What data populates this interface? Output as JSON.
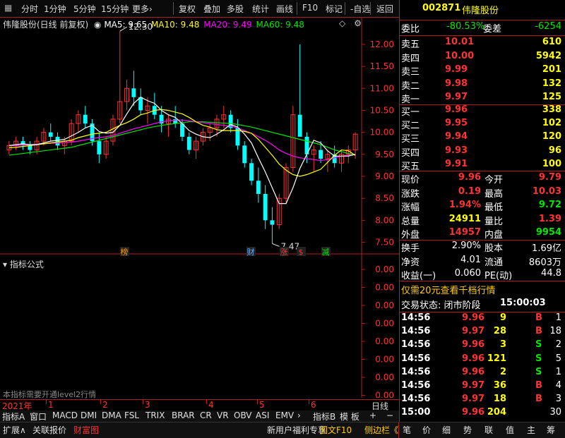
{
  "toolbar": {
    "items": [
      "分时",
      "1分钟",
      "5分钟",
      "15分钟",
      "更多›",
      "复权",
      "叠加",
      "多股",
      "统计",
      "画线",
      "F10",
      "标记",
      "-自选",
      "返回"
    ]
  },
  "chart": {
    "title": "伟隆股份(日线 前复权)",
    "ma5": "MA5: 9.65",
    "ma10": "MA10: 9.48",
    "ma20": "MA20: 9.49",
    "ma60": "MA60: 9.48",
    "high_mark": "12.30",
    "low_mark": "7.47",
    "y_ticks": [
      "12.00",
      "11.50",
      "11.00",
      "10.50",
      "10.00",
      "9.50",
      "9.00",
      "8.50",
      "8.00",
      "7.50"
    ],
    "markers": [
      "榜",
      "财",
      "涨",
      "$",
      "减"
    ],
    "colors": {
      "up": "#ff3232",
      "down": "#00ffff",
      "ma5": "#ffffff",
      "ma10": "#ffff00",
      "ma20": "#ff00ff",
      "ma60": "#00e600"
    }
  },
  "chart_data": {
    "type": "candlestick",
    "ylim": [
      7.3,
      12.4
    ],
    "candles": [
      [
        9.6,
        9.8,
        9.5,
        9.7
      ],
      [
        9.7,
        9.9,
        9.6,
        9.8
      ],
      [
        9.8,
        9.9,
        9.6,
        9.7
      ],
      [
        9.7,
        9.8,
        9.5,
        9.6
      ],
      [
        9.6,
        9.9,
        9.5,
        9.8
      ],
      [
        9.8,
        10.1,
        9.7,
        10.0
      ],
      [
        10.0,
        10.2,
        9.8,
        9.9
      ],
      [
        9.9,
        10.0,
        9.6,
        9.7
      ],
      [
        9.7,
        9.9,
        9.5,
        9.8
      ],
      [
        9.8,
        10.3,
        9.7,
        10.2
      ],
      [
        10.2,
        10.5,
        10.0,
        10.4
      ],
      [
        10.4,
        10.6,
        10.1,
        10.2
      ],
      [
        10.2,
        10.3,
        9.7,
        9.8
      ],
      [
        9.8,
        10.0,
        9.3,
        9.5
      ],
      [
        9.5,
        9.9,
        9.4,
        9.8
      ],
      [
        9.8,
        10.4,
        9.7,
        10.3
      ],
      [
        10.3,
        12.3,
        10.2,
        10.7
      ],
      [
        10.7,
        11.2,
        10.5,
        11.0
      ],
      [
        11.0,
        11.4,
        10.6,
        10.8
      ],
      [
        10.8,
        11.0,
        10.4,
        10.5
      ],
      [
        10.5,
        10.8,
        10.2,
        10.6
      ],
      [
        10.6,
        10.9,
        10.3,
        10.4
      ],
      [
        10.4,
        10.6,
        10.0,
        10.2
      ],
      [
        10.2,
        10.4,
        9.9,
        10.3
      ],
      [
        10.3,
        10.6,
        10.1,
        10.2
      ],
      [
        10.2,
        10.3,
        9.8,
        9.9
      ],
      [
        9.9,
        10.0,
        9.5,
        9.6
      ],
      [
        9.6,
        9.9,
        9.4,
        9.8
      ],
      [
        9.8,
        10.1,
        9.7,
        10.0
      ],
      [
        10.0,
        10.2,
        9.8,
        10.1
      ],
      [
        10.1,
        10.4,
        9.9,
        10.3
      ],
      [
        10.3,
        10.6,
        10.1,
        10.4
      ],
      [
        10.4,
        10.5,
        10.0,
        10.1
      ],
      [
        10.1,
        10.3,
        9.6,
        9.7
      ],
      [
        9.7,
        9.8,
        9.2,
        9.3
      ],
      [
        9.3,
        9.4,
        8.8,
        8.9
      ],
      [
        8.9,
        9.2,
        8.4,
        8.6
      ],
      [
        8.6,
        8.8,
        7.8,
        8.0
      ],
      [
        8.0,
        8.3,
        7.47,
        7.9
      ],
      [
        7.9,
        8.6,
        7.8,
        8.5
      ],
      [
        8.5,
        9.3,
        8.4,
        9.2
      ],
      [
        9.2,
        10.6,
        9.1,
        10.4
      ],
      [
        10.4,
        12.0,
        10.2,
        9.9
      ],
      [
        9.9,
        10.0,
        9.3,
        9.5
      ],
      [
        9.5,
        9.7,
        9.1,
        9.6
      ],
      [
        9.6,
        9.8,
        9.3,
        9.4
      ],
      [
        9.4,
        9.6,
        9.1,
        9.5
      ],
      [
        9.5,
        9.7,
        9.2,
        9.3
      ],
      [
        9.3,
        9.6,
        9.1,
        9.5
      ],
      [
        9.5,
        9.7,
        9.3,
        9.6
      ],
      [
        9.6,
        10.0,
        9.4,
        9.96
      ]
    ],
    "ma5": [
      9.7,
      9.72,
      9.74,
      9.72,
      9.72,
      9.76,
      9.8,
      9.82,
      9.84,
      9.92,
      10.0,
      10.1,
      10.16,
      10.02,
      9.98,
      10.0,
      10.16,
      10.42,
      10.66,
      10.8,
      10.72,
      10.66,
      10.5,
      10.4,
      10.34,
      10.2,
      10.04,
      9.96,
      9.9,
      9.88,
      9.96,
      10.06,
      10.18,
      10.12,
      9.96,
      9.76,
      9.42,
      9.1,
      8.74,
      8.38,
      8.38,
      8.74,
      9.18,
      9.5,
      9.82,
      9.76,
      9.58,
      9.46,
      9.46,
      9.46,
      9.5
    ],
    "ma10": [
      9.65,
      9.66,
      9.68,
      9.7,
      9.72,
      9.74,
      9.76,
      9.78,
      9.8,
      9.82,
      9.88,
      9.92,
      9.96,
      9.98,
      10.0,
      10.08,
      10.16,
      10.22,
      10.3,
      10.4,
      10.44,
      10.5,
      10.52,
      10.5,
      10.46,
      10.42,
      10.34,
      10.24,
      10.16,
      10.12,
      10.06,
      10.04,
      10.04,
      10.04,
      10.02,
      9.98,
      9.84,
      9.66,
      9.48,
      9.28,
      9.14,
      9.04,
      9.0,
      9.04,
      9.1,
      9.16,
      9.32,
      9.48,
      9.6,
      9.58,
      9.48
    ],
    "ma20": [
      9.7,
      9.7,
      9.71,
      9.72,
      9.73,
      9.74,
      9.75,
      9.76,
      9.77,
      9.78,
      9.8,
      9.83,
      9.86,
      9.88,
      9.9,
      9.93,
      9.98,
      10.03,
      10.08,
      10.12,
      10.16,
      10.2,
      10.24,
      10.26,
      10.28,
      10.28,
      10.26,
      10.24,
      10.22,
      10.2,
      10.18,
      10.16,
      10.14,
      10.1,
      10.04,
      9.98,
      9.9,
      9.82,
      9.72,
      9.6,
      9.52,
      9.46,
      9.42,
      9.4,
      9.38,
      9.36,
      9.38,
      9.42,
      9.46,
      9.48,
      9.49
    ],
    "ma60": [
      9.48,
      9.5,
      9.52,
      9.54,
      9.56,
      9.58,
      9.6,
      9.62,
      9.64,
      9.66,
      9.7,
      9.74,
      9.78,
      9.82,
      9.86,
      9.9,
      9.94,
      9.98,
      10.02,
      10.06,
      10.1,
      10.13,
      10.16,
      10.18,
      10.2,
      10.22,
      10.24,
      10.24,
      10.24,
      10.23,
      10.22,
      10.21,
      10.2,
      10.18,
      10.15,
      10.12,
      10.08,
      10.04,
      10.0,
      9.96,
      9.92,
      9.88,
      9.84,
      9.8,
      9.76,
      9.72,
      9.66,
      9.6,
      9.56,
      9.52,
      9.48
    ]
  },
  "indicator": {
    "title": "指标公式",
    "ticks": [
      "0.00",
      "0.00",
      "0.00",
      "0.00",
      "0.00",
      "0.00",
      "0.00",
      "0.00"
    ],
    "notice": "本指标需要开通level2行情"
  },
  "timeline": {
    "labels": [
      "2021年",
      "1",
      "2",
      "3",
      "4",
      "5",
      "6"
    ],
    "mode": "日线"
  },
  "indicator_tabs": [
    "指标A",
    "窗口",
    "MACD",
    "DMI",
    "DMA",
    "FSL",
    "TRIX",
    "BRAR",
    "CR",
    "VR",
    "OBV",
    "ASI",
    "EMV",
    "›",
    "指标B",
    "模 板",
    "+",
    "−"
  ],
  "bottom_tabs": [
    "扩展∧",
    "关联报价",
    "财富图",
    "新用户福利专享",
    "图文F10",
    "侧边栏《",
    "笔",
    "价",
    "细",
    "势",
    "联",
    "值",
    "主",
    "筹"
  ],
  "quote": {
    "code": "002871",
    "name": "伟隆股份",
    "weibi_label": "委比",
    "weibi": "-80.53%",
    "weicha_label": "委差",
    "weicha": "-6254",
    "asks": [
      {
        "label": "卖五",
        "price": "10.01",
        "vol": "610"
      },
      {
        "label": "卖四",
        "price": "10.00",
        "vol": "5942"
      },
      {
        "label": "卖三",
        "price": "9.99",
        "vol": "201"
      },
      {
        "label": "卖二",
        "price": "9.98",
        "vol": "132"
      },
      {
        "label": "卖一",
        "price": "9.97",
        "vol": "125"
      }
    ],
    "bids": [
      {
        "label": "买一",
        "price": "9.96",
        "vol": "338"
      },
      {
        "label": "买二",
        "price": "9.95",
        "vol": "102"
      },
      {
        "label": "买三",
        "price": "9.94",
        "vol": "120"
      },
      {
        "label": "买四",
        "price": "9.93",
        "vol": "96"
      },
      {
        "label": "买五",
        "price": "9.91",
        "vol": "100"
      }
    ],
    "stats": [
      {
        "l1": "现价",
        "v1": "9.96",
        "l2": "今开",
        "v2": "9.79"
      },
      {
        "l1": "涨跌",
        "v1": "0.19",
        "l2": "最高",
        "v2": "10.03"
      },
      {
        "l1": "涨幅",
        "v1": "1.94%",
        "l2": "最低",
        "v2": "9.72"
      },
      {
        "l1": "总量",
        "v1": "24911",
        "l2": "量比",
        "v2": "1.39"
      },
      {
        "l1": "外盘",
        "v1": "14957",
        "l2": "内盘",
        "v2": "9954"
      }
    ],
    "stats2": [
      {
        "l1": "换手",
        "v1": "2.90%",
        "l2": "股本",
        "v2": "1.69亿"
      },
      {
        "l1": "净资",
        "v1": "4.01",
        "l2": "流通",
        "v2": "8603万"
      },
      {
        "l1": "收益(一)",
        "v1": "0.060",
        "l2": "PE(动)",
        "v2": "44.8"
      }
    ],
    "promo": "仅需20元查看千档行情",
    "status_label": "交易状态: 闭市阶段",
    "status_time": "15:00:03",
    "ticks": [
      {
        "t": "14:56",
        "p": "9.96",
        "v": "9",
        "s": "B",
        "n": "1"
      },
      {
        "t": "14:56",
        "p": "9.97",
        "v": "28",
        "s": "B",
        "n": "18"
      },
      {
        "t": "14:56",
        "p": "9.96",
        "v": "3",
        "s": "S",
        "n": "2"
      },
      {
        "t": "14:56",
        "p": "9.96",
        "v": "121",
        "s": "S",
        "n": "5"
      },
      {
        "t": "14:56",
        "p": "9.96",
        "v": "2",
        "s": "S",
        "n": "1"
      },
      {
        "t": "14:56",
        "p": "9.97",
        "v": "36",
        "s": "B",
        "n": "4"
      },
      {
        "t": "14:56",
        "p": "9.97",
        "v": "18",
        "s": "B",
        "n": "3"
      },
      {
        "t": "15:00",
        "p": "9.96",
        "v": "204",
        "s": "",
        "n": "30"
      }
    ]
  }
}
